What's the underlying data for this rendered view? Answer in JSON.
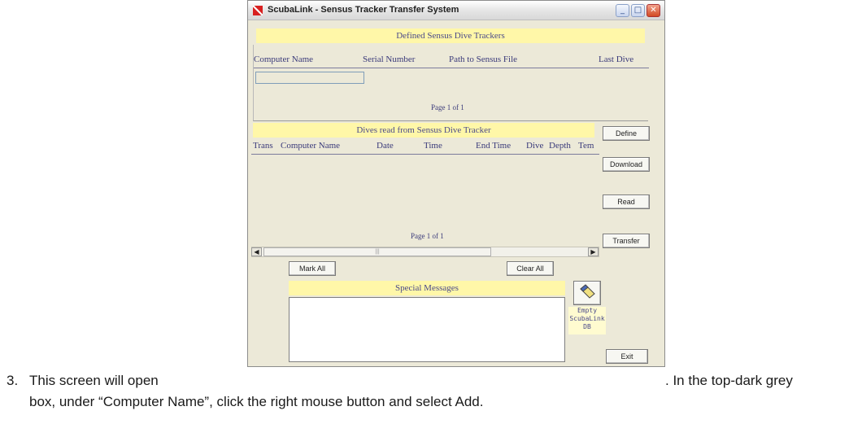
{
  "document": {
    "list_number": "3.",
    "line1_before": "This screen will open",
    "line1_after": ". In the top-dark grey",
    "line2": "box, under “Computer Name”, click the right mouse button and select Add."
  },
  "window": {
    "title": "ScubaLink - Sensus Tracker Transfer System",
    "controls": {
      "minimize": "_",
      "maximize": "□",
      "close": "✕"
    }
  },
  "trackers": {
    "band": "Defined Sensus Dive Trackers",
    "columns": [
      "Computer Name",
      "Serial Number",
      "Path to Sensus File",
      "Last Dive"
    ],
    "pager": "Page 1 of 1"
  },
  "dives": {
    "band": "Dives read from Sensus Dive Tracker",
    "columns": [
      "Trans",
      "Computer Name",
      "Date",
      "Time",
      "End Time",
      "Dive",
      "Depth",
      "Tem"
    ],
    "pager": "Page 1 of 1",
    "scroll_thumb": "|||"
  },
  "side_buttons": {
    "define": "Define",
    "download": "Download",
    "read": "Read",
    "transfer": "Transfer",
    "exit": "Exit"
  },
  "bottom_buttons": {
    "mark_all": "Mark All",
    "clear_all": "Clear All"
  },
  "messages": {
    "band": "Special Messages"
  },
  "empty_db": {
    "line1": "Empty",
    "line2": "ScubaLink",
    "line3": "DB"
  },
  "colors": {
    "band_yellow": "#fff7a8",
    "panel": "#ece9d8",
    "header_text": "#3a3a7a",
    "close_red": "#d24a24"
  }
}
